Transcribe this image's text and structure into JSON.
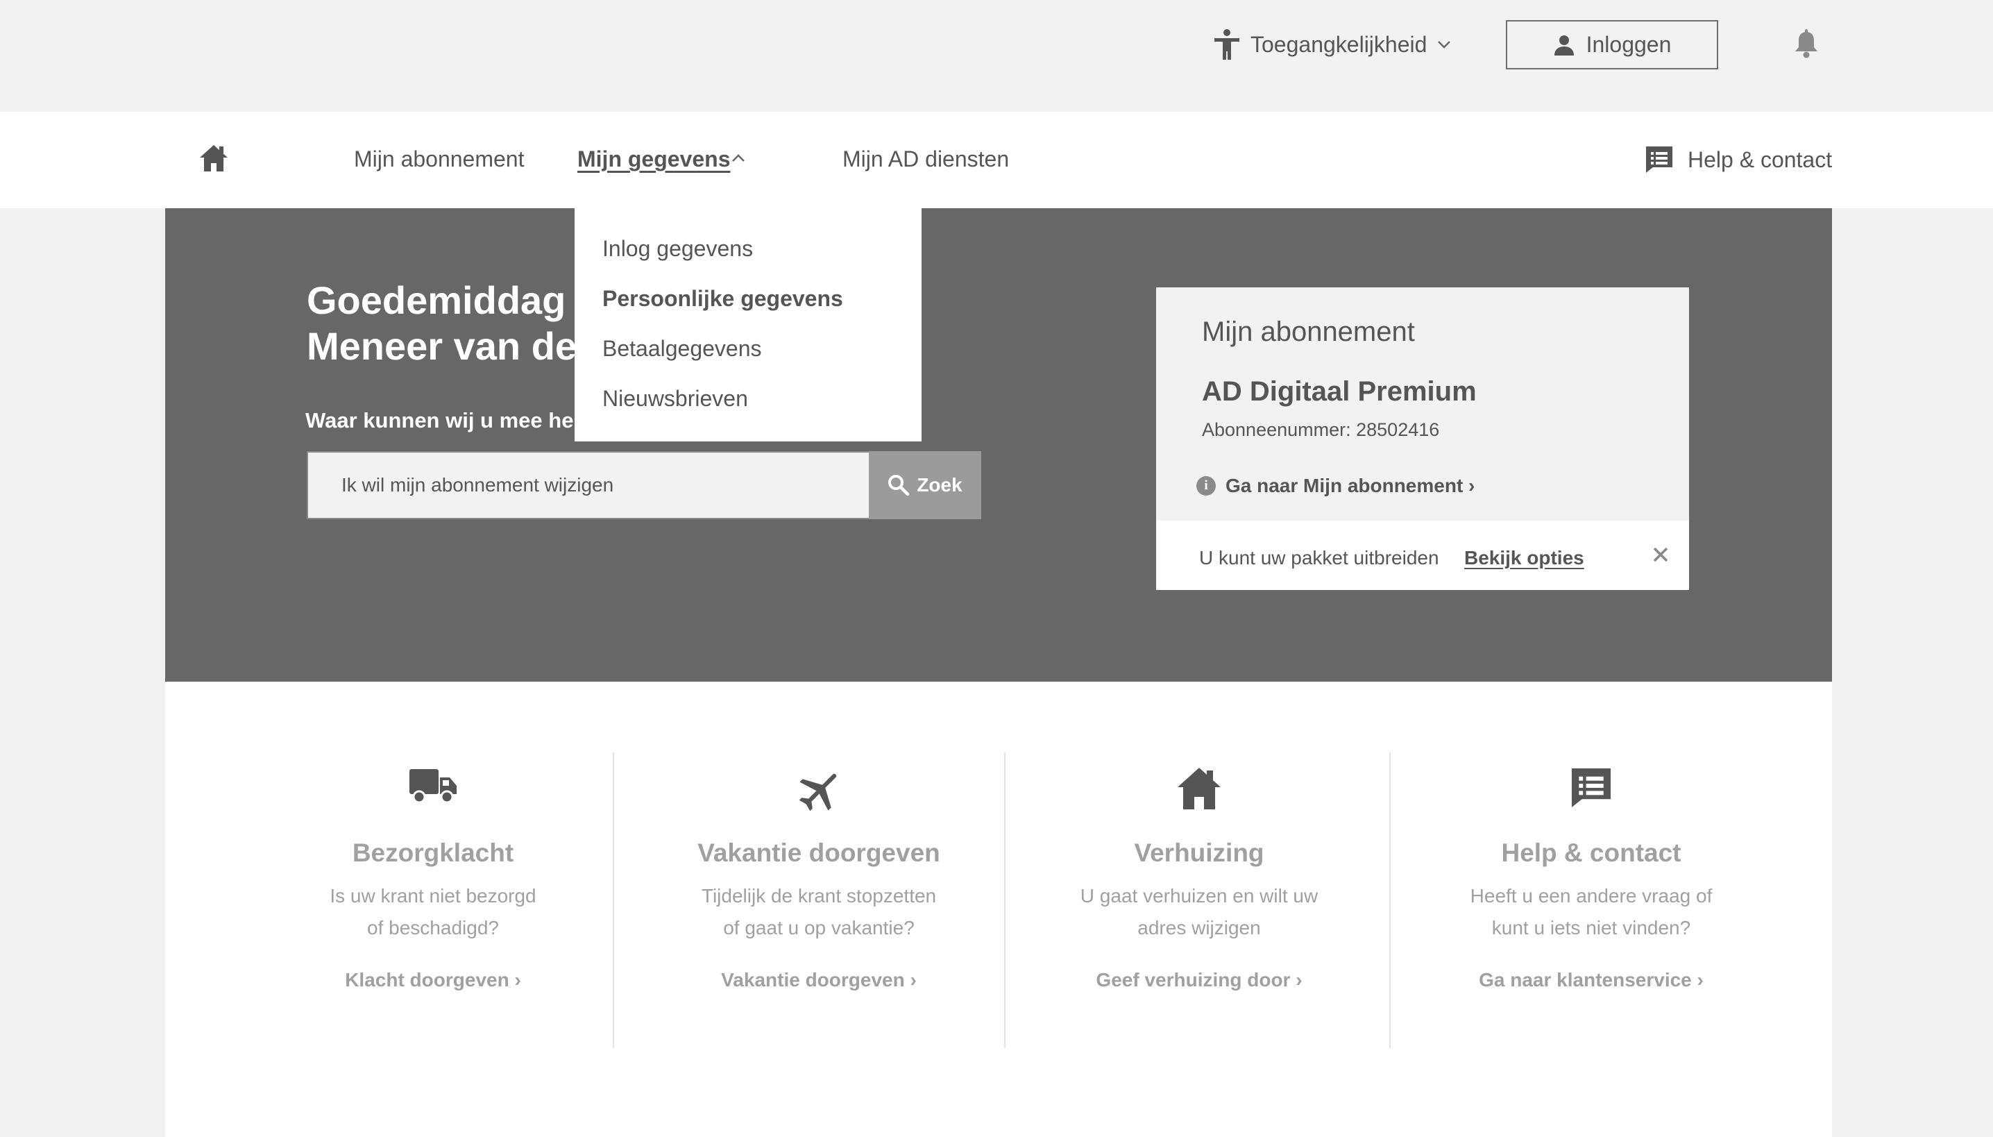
{
  "topbar": {
    "accessibility_label": "Toegangkelijkheid",
    "login_label": "Inloggen"
  },
  "nav": {
    "items": [
      {
        "label": "Mijn abonnement"
      },
      {
        "label": "Mijn gegevens"
      },
      {
        "label": "Mijn AD diensten"
      }
    ],
    "help_label": "Help & contact"
  },
  "dropdown": {
    "items": [
      {
        "label": "Inlog gegevens"
      },
      {
        "label": "Persoonlijke gegevens"
      },
      {
        "label": "Betaalgegevens"
      },
      {
        "label": "Nieuwsbrieven"
      }
    ]
  },
  "hero": {
    "greeting": "Goedemiddag\nMeneer van de",
    "help_question": "Waar kunnen wij u mee hel",
    "search": {
      "value": "Ik wil mijn abonnement wijzigen",
      "button_label": "Zoek"
    }
  },
  "subscription_card": {
    "title": "Mijn abonnement",
    "product": "AD Digitaal Premium",
    "number_label": "Abonneenummer: 28502416",
    "link_label": "Ga naar Mijn abonnement ›",
    "upsell_text": "U kunt uw pakket uitbreiden",
    "upsell_link": "Bekijk opties"
  },
  "services": [
    {
      "icon": "truck-icon",
      "title": "Bezorgklacht",
      "desc": "Is uw krant niet bezorgd\nof beschadigd?",
      "link": "Klacht doorgeven ›"
    },
    {
      "icon": "airplane-icon",
      "title": "Vakantie doorgeven",
      "desc": "Tijdelijk de krant stopzetten\nof gaat u op vakantie?",
      "link": "Vakantie doorgeven ›"
    },
    {
      "icon": "house-icon",
      "title": "Verhuizing",
      "desc": "U gaat verhuizen en wilt uw\nadres wijzigen",
      "link": "Geef verhuizing door ›"
    },
    {
      "icon": "chat-list-icon",
      "title": "Help & contact",
      "desc": "Heeft u een andere vraag of\nkunt u iets niet vinden?",
      "link": "Ga naar klantenservice ›"
    }
  ],
  "colors": {
    "hero_bg": "#676767",
    "page_bg": "#f2f2f2",
    "text": "#555555",
    "muted": "#a0a0a0"
  }
}
